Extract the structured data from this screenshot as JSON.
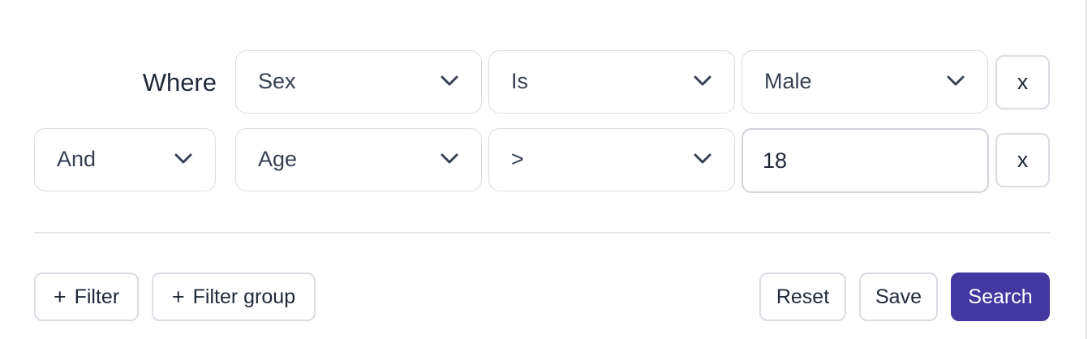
{
  "filters": {
    "rows": [
      {
        "connector": "Where",
        "field": "Sex",
        "operator": "Is",
        "value": "Male",
        "remove_label": "x"
      },
      {
        "connector": "And",
        "field": "Age",
        "operator": ">",
        "value": "18",
        "remove_label": "x"
      }
    ]
  },
  "actions": {
    "add_filter": {
      "icon": "+",
      "label": "Filter"
    },
    "add_filter_group": {
      "icon": "+",
      "label": "Filter group"
    },
    "reset_label": "Reset",
    "save_label": "Save",
    "search_label": "Search"
  },
  "colors": {
    "primary": "#4338a0",
    "border": "#d9dde3",
    "text": "#1f2937"
  },
  "icons": {
    "dropdown": "chevron-down-icon",
    "add": "plus-icon"
  }
}
